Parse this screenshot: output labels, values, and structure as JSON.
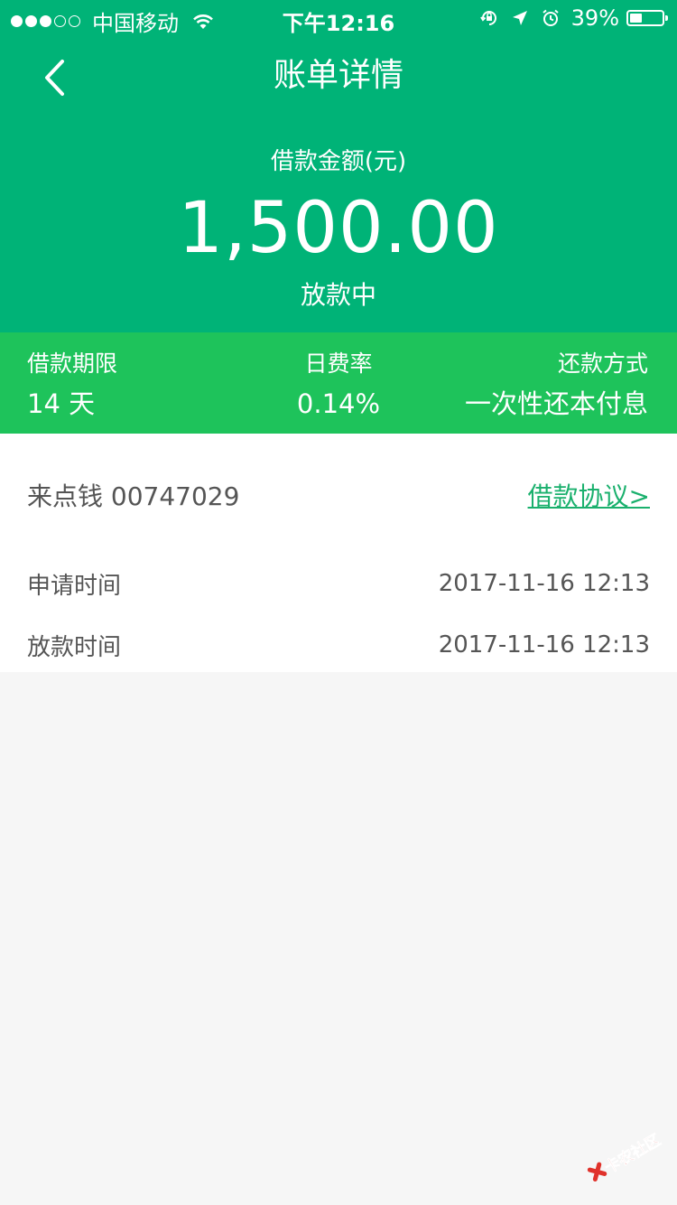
{
  "status_bar": {
    "carrier": "中国移动",
    "time": "下午12:16",
    "battery_percent": "39%",
    "battery_level": 0.39,
    "icons": [
      "signal-dots",
      "wifi-icon",
      "rotation-lock-icon",
      "location-arrow-icon",
      "alarm-icon",
      "battery-icon"
    ]
  },
  "nav": {
    "back_icon": "chevron-left-icon",
    "title": "账单详情"
  },
  "summary": {
    "amount_label": "借款金额(元)",
    "amount": "1,500.00",
    "status": "放款中"
  },
  "terms": [
    {
      "label": "借款期限",
      "value": "14 天"
    },
    {
      "label": "日费率",
      "value": "0.14%"
    },
    {
      "label": "还款方式",
      "value": "一次性还本付息"
    }
  ],
  "details": {
    "product": "来点钱 00747029",
    "agreement_link": "借款协议>",
    "rows": [
      {
        "label": "申请时间",
        "value": "2017-11-16 12:13"
      },
      {
        "label": "放款时间",
        "value": "2017-11-16 12:13"
      }
    ]
  },
  "watermark": {
    "text": "卡农社区"
  },
  "colors": {
    "header_bg": "#00b377",
    "strip_bg": "#1ec35b",
    "link": "#1ab06d",
    "page_bg": "#f6f6f6",
    "text": "#555555",
    "watermark_red": "#e0322b"
  }
}
